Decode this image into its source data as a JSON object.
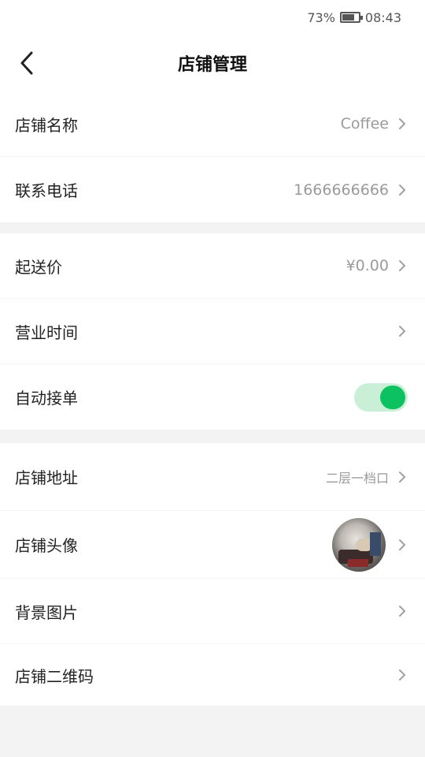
{
  "status_bar": {
    "battery_percent_text": "73%",
    "battery_level": 0.73,
    "time": "08:43"
  },
  "header": {
    "title": "店铺管理"
  },
  "groups": [
    {
      "rows": [
        {
          "label": "店铺名称",
          "value": "Coffee"
        },
        {
          "label": "联系电话",
          "value": "1666666666"
        }
      ]
    },
    {
      "rows": [
        {
          "label": "起送价",
          "value": "¥0.00"
        },
        {
          "label": "营业时间",
          "value": ""
        },
        {
          "label": "自动接单",
          "toggle_on": true
        }
      ]
    },
    {
      "rows": [
        {
          "label": "店铺地址",
          "value": "二层一档口"
        },
        {
          "label": "店铺头像",
          "avatar": true
        },
        {
          "label": "背景图片",
          "value": ""
        },
        {
          "label": "店铺二维码",
          "value": ""
        }
      ]
    }
  ],
  "colors": {
    "accent_green": "#0cc160",
    "toggle_track": "#c9f0d7",
    "page_bg": "#f3f3f3"
  },
  "icons": {
    "back": "chevron-left-icon",
    "row_arrow": "chevron-right-icon",
    "battery": "battery-icon"
  }
}
